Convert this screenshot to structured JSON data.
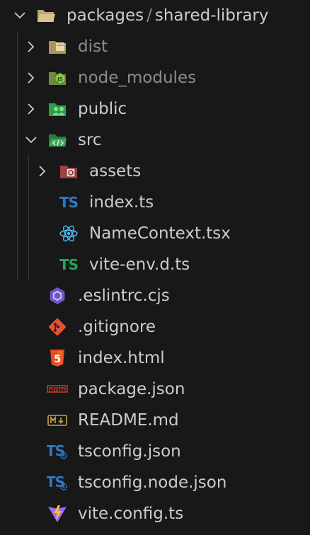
{
  "tree": {
    "root": {
      "folder": "packages",
      "separator": "/",
      "subfolder": "shared-library"
    },
    "dist": "dist",
    "node_modules": "node_modules",
    "public": "public",
    "src": "src",
    "assets": "assets",
    "index_ts": "index.ts",
    "name_context": "NameContext.tsx",
    "vite_env": "vite-env.d.ts",
    "eslintrc": ".eslintrc.cjs",
    "gitignore": ".gitignore",
    "index_html": "index.html",
    "package_json": "package.json",
    "readme": "README.md",
    "tsconfig": "tsconfig.json",
    "tsconfig_node": "tsconfig.node.json",
    "vite_config": "vite.config.ts"
  },
  "colors": {
    "background": "#181818",
    "text": "#cccccc",
    "dimmed_text": "#8c8c8c",
    "typescript_blue": "#3178c6",
    "typescript_green": "#1fa85a",
    "react": "#4fb8e8",
    "html": "#e44d26",
    "git": "#e8512f",
    "eslint": "#6d56c9",
    "npm": "#c0392b",
    "markdown": "#c8a24a",
    "vite": "#9f6bff"
  }
}
